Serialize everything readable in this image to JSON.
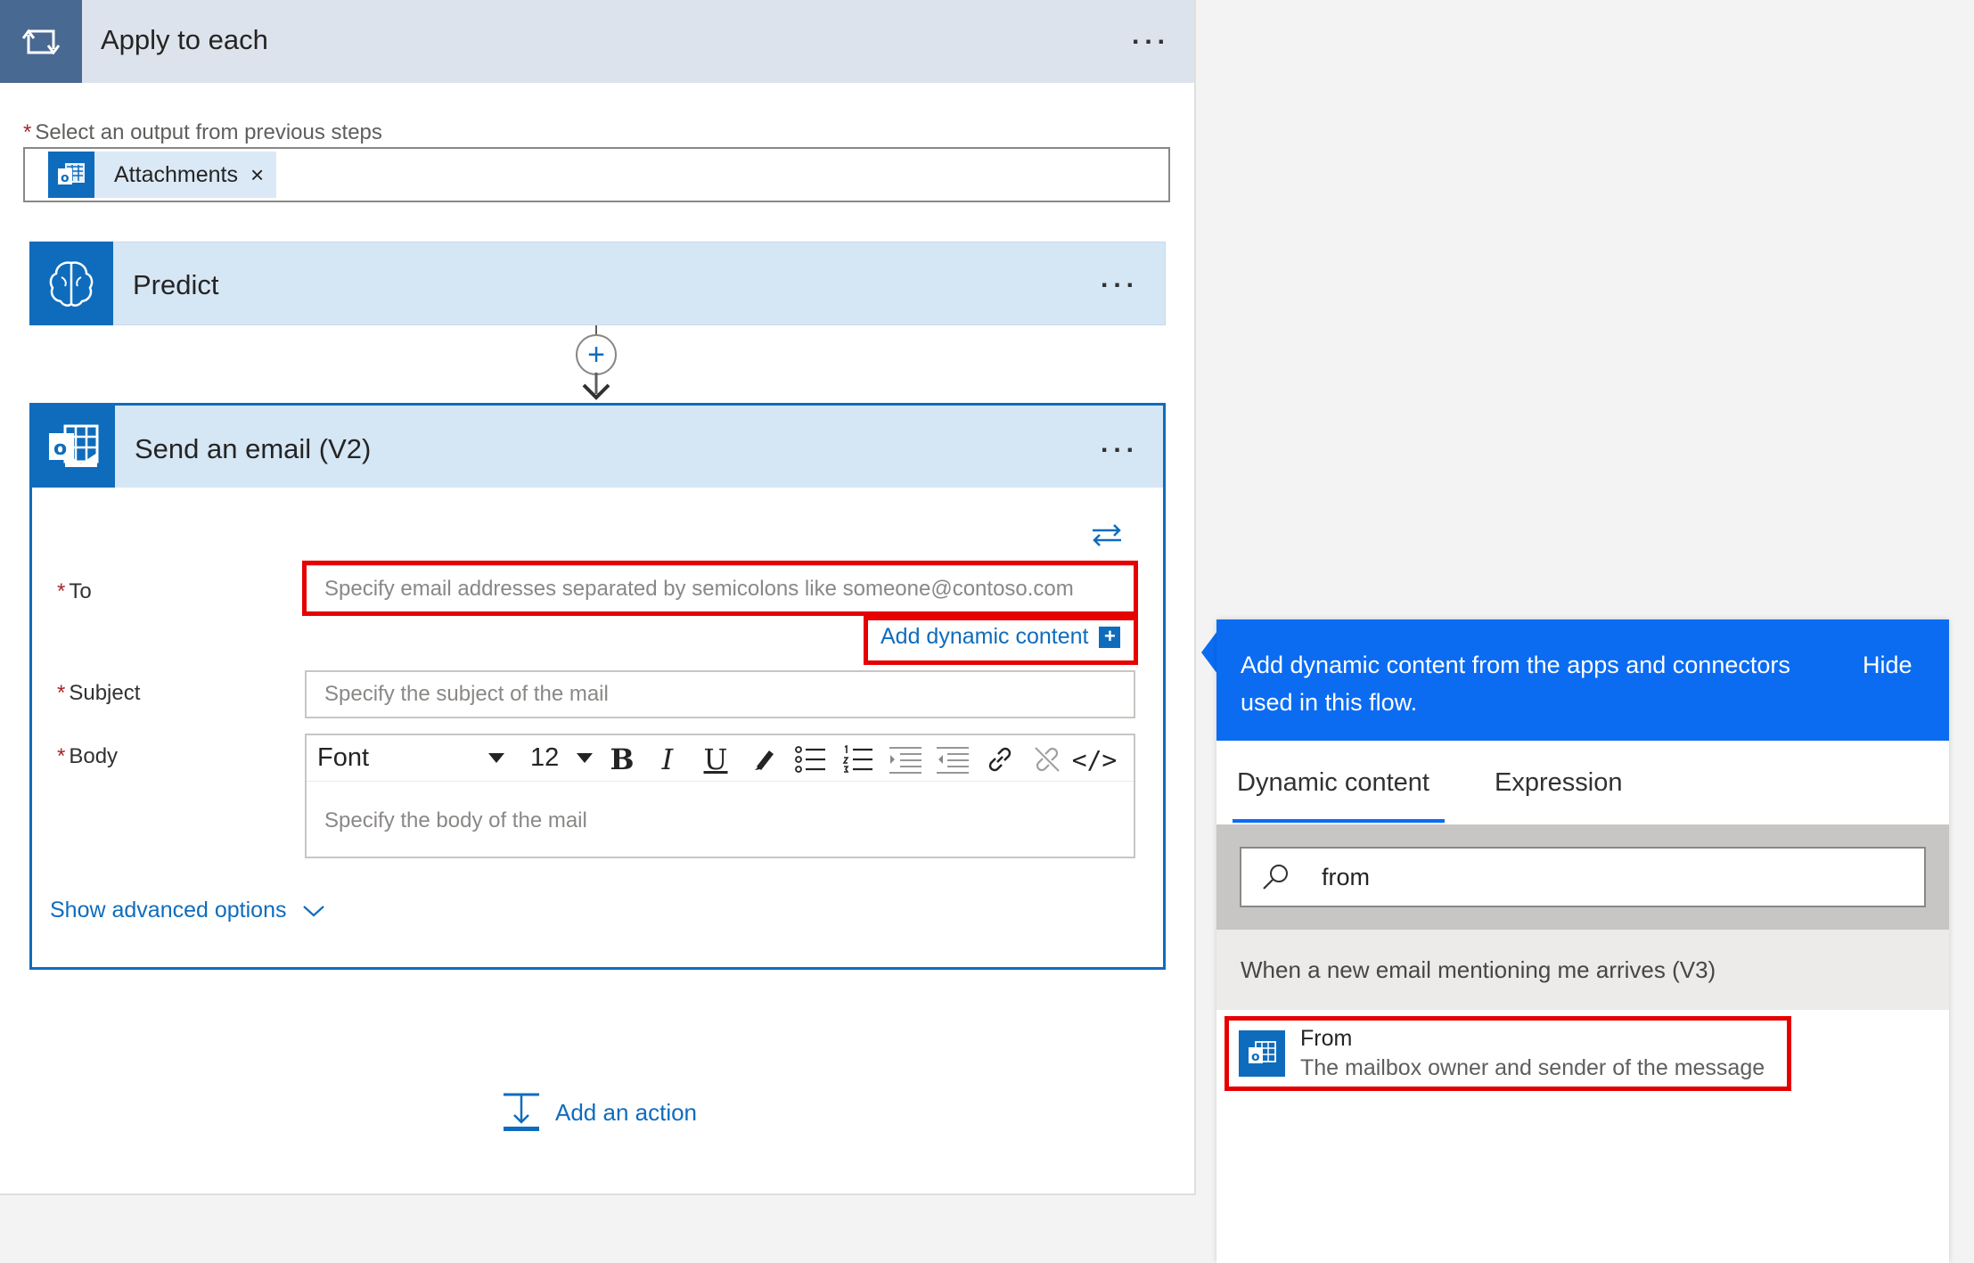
{
  "apply_to_each": {
    "title": "Apply to each",
    "more_label": "...",
    "select_label": "Select an output from previous steps",
    "required_mark": "*",
    "token": {
      "label": "Attachments",
      "remove": "×",
      "icon": "outlook-icon"
    }
  },
  "predict": {
    "title": "Predict",
    "more_label": "...",
    "icon": "ai-brain-icon"
  },
  "connector": {
    "plus": "+"
  },
  "send_email": {
    "title": "Send an email (V2)",
    "more_label": "...",
    "icon": "outlook-icon",
    "fields": {
      "to": {
        "label": "To",
        "placeholder": "Specify email addresses separated by semicolons like someone@contoso.com"
      },
      "subject": {
        "label": "Subject",
        "placeholder": "Specify the subject of the mail"
      },
      "body": {
        "label": "Body",
        "placeholder": "Specify the body of the mail"
      }
    },
    "add_dynamic_content": "Add dynamic content",
    "add_dynamic_plus": "+",
    "toolbar": {
      "font": "Font",
      "size": "12",
      "bold": "B",
      "italic": "I",
      "underline": "U",
      "code": "</>"
    },
    "show_advanced": "Show advanced options"
  },
  "add_action": {
    "label": "Add an action"
  },
  "dynamic_panel": {
    "description": "Add dynamic content from the apps and connectors used in this flow.",
    "hide": "Hide",
    "tabs": [
      {
        "label": "Dynamic content",
        "active": true
      },
      {
        "label": "Expression",
        "active": false
      }
    ],
    "search": {
      "value": "from"
    },
    "group": "When a new email mentioning me arrives (V3)",
    "items": [
      {
        "title": "From",
        "description": "The mailbox owner and sender of the message",
        "icon": "outlook-icon"
      }
    ]
  },
  "colors": {
    "accent": "#0f6cbd",
    "panel_header": "#0b6cf2",
    "highlight": "#e60000",
    "apply_header": "#486991"
  }
}
